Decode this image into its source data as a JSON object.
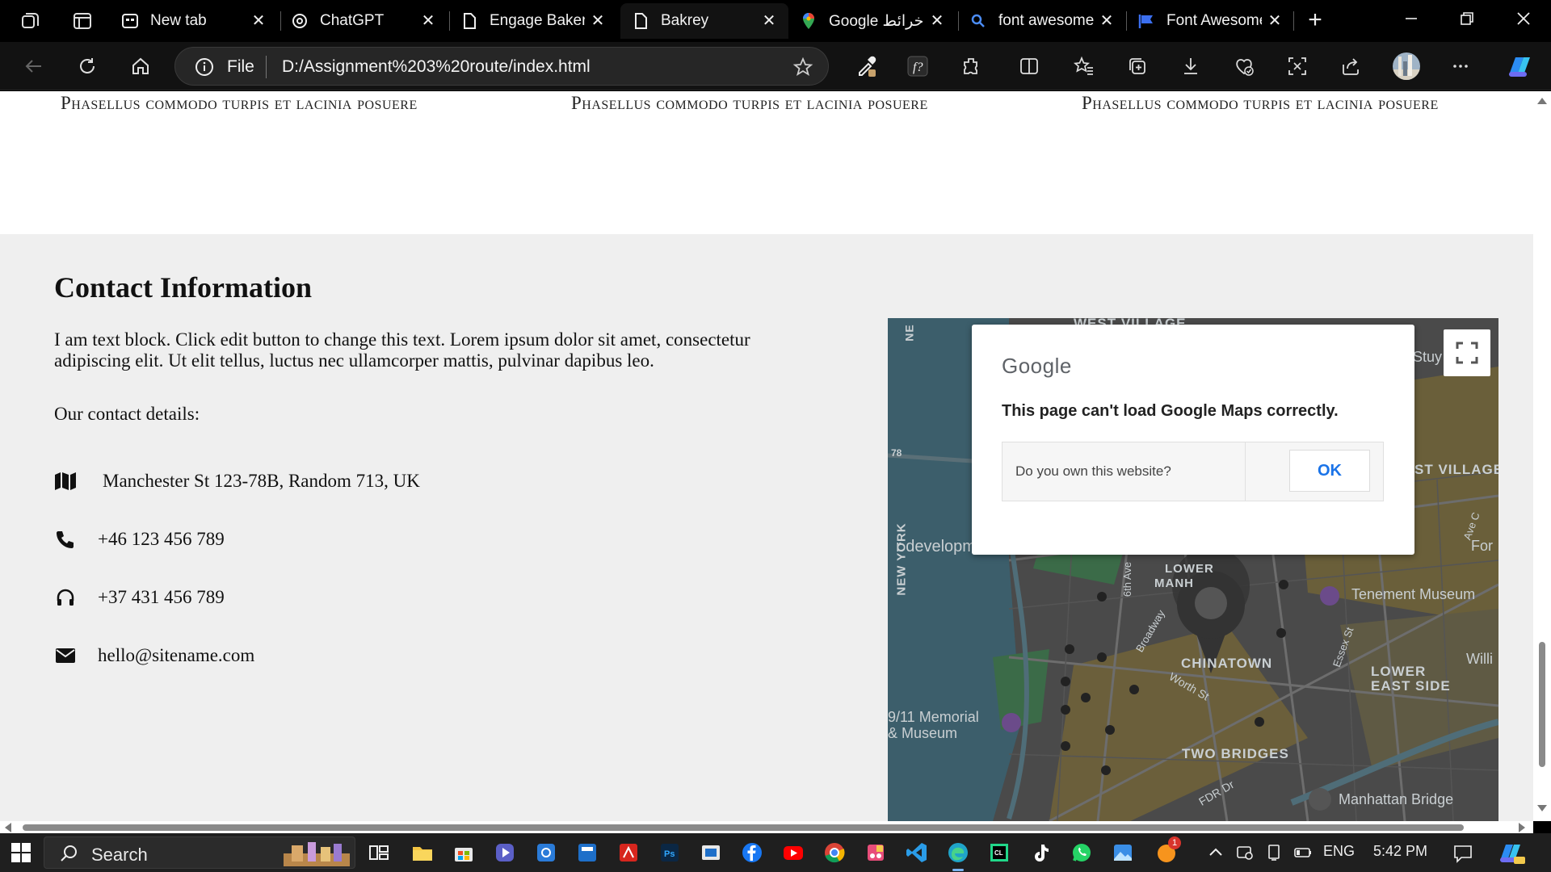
{
  "browser": {
    "tabs": [
      {
        "title": "New tab",
        "icon": "newtab-icon",
        "active": false
      },
      {
        "title": "ChatGPT",
        "icon": "chatgpt-icon",
        "active": false
      },
      {
        "title": "Engage Bakery",
        "icon": "page-icon",
        "active": false
      },
      {
        "title": "Bakrey",
        "icon": "page-icon",
        "active": true
      },
      {
        "title": "Google خرائط",
        "icon": "google-maps-icon",
        "active": false
      },
      {
        "title": "font awesome",
        "icon": "search-icon",
        "active": false
      },
      {
        "title": "Font Awesome",
        "icon": "font-awesome-flag-icon",
        "active": false
      }
    ],
    "close_glyph": "✕",
    "address": {
      "scheme_label": "File",
      "url": "D:/Assignment%203%20route/index.html"
    }
  },
  "page": {
    "features": [
      "Phasellus commodo turpis et lacinia posuere",
      "Phasellus commodo turpis et lacinia posuere",
      "Phasellus commodo turpis et lacinia posuere"
    ],
    "contact": {
      "heading": "Contact Information",
      "paragraph": "I am text block. Click edit button to change this text. Lorem ipsum dolor sit amet, consectetur adipiscing elit. Ut elit tellus, luctus nec ullamcorper mattis, pulvinar dapibus leo.",
      "details_label": "Our contact details:",
      "items": [
        {
          "icon": "map-icon",
          "text": "Manchester St 123-78B, Random 713, UK"
        },
        {
          "icon": "phone-icon",
          "text": "+46 123 456 789"
        },
        {
          "icon": "headphones-icon",
          "text": "+37 431 456 789"
        },
        {
          "icon": "envelope-icon",
          "text": "hello@sitename.com"
        }
      ]
    },
    "map": {
      "error_logo": "Google",
      "error_message": "This page can't load Google Maps correctly.",
      "question": "Do you own this website?",
      "ok_label": "OK",
      "labels": {
        "west_village": "WEST VILLAGE",
        "east_village": "ST VILLAGE",
        "chinatown": "CHINATOWN",
        "lower_east_side_1": "LOWER",
        "lower_east_side_2": "EAST SIDE",
        "two_bridges": "TWO BRIDGES",
        "tenement": "Tenement Museum",
        "memorial_1": "9/11 Memorial",
        "memorial_2": "& Museum",
        "manhattan_bridge": "Manhattan Bridge",
        "development": "r developm",
        "broadway": "Broadway",
        "sixth_ave": "6th Ave",
        "worth_st": "Worth St",
        "essex_st": "Essex St",
        "lower_manh": "LOWER",
        "manh": "MANH",
        "new_york": "NEW YORK",
        "route_78": "78",
        "fdr": "FDR Dr",
        "stuy": "Stuy",
        "for": "For",
        "willi": "Willi",
        "ave_c": "Ave C",
        "ne": "NE"
      }
    }
  },
  "taskbar": {
    "search_label": "Search",
    "language": "ENG",
    "time": "5:42 PM",
    "notification_badge": "1"
  }
}
